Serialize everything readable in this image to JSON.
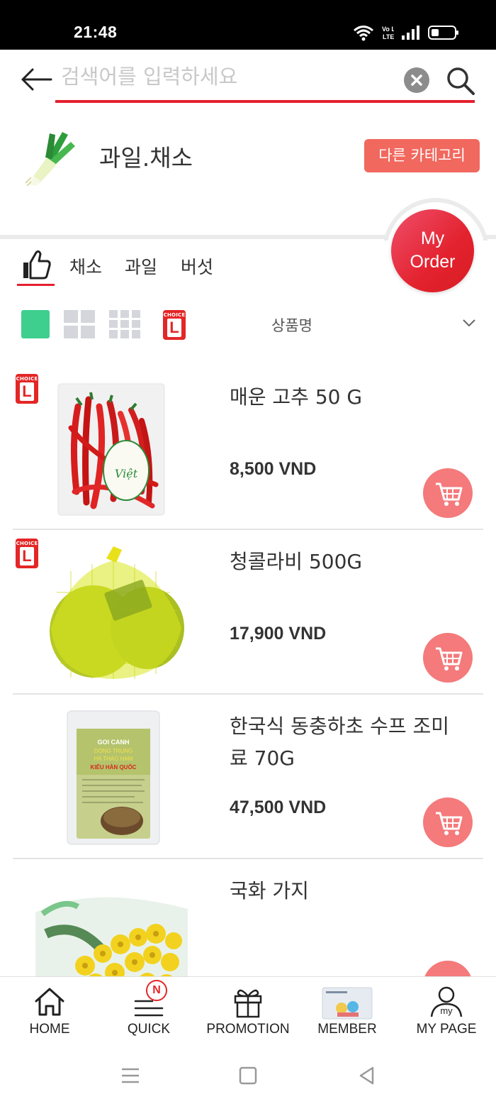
{
  "status_bar": {
    "time": "21:48",
    "network_label": "Vo LTE"
  },
  "search": {
    "placeholder": "검색어를 입력하세요",
    "value": ""
  },
  "category": {
    "title": "과일.채소",
    "other_button": "다른 카테고리"
  },
  "my_order": {
    "line1": "My",
    "line2": "Order"
  },
  "tabs": [
    {
      "label": "채소"
    },
    {
      "label": "과일"
    },
    {
      "label": "버섯"
    }
  ],
  "choice_badge": {
    "top": "CHOICE",
    "letter": "L"
  },
  "sort": {
    "label": "상품명"
  },
  "products": [
    {
      "name": "매운 고추 50 G",
      "price": "8,500 VND",
      "choice": true
    },
    {
      "name": "청콜라비 500G",
      "price": "17,900 VND",
      "choice": true
    },
    {
      "name": "한국식 동충하초 수프 조미료 70G",
      "price": "47,500 VND",
      "choice": false,
      "package_text": {
        "line1": "GOI CANH",
        "line2": "DONG TRUNG",
        "line3": "HA THAO HAM",
        "line4": "KIỂU HÀN QUỐC"
      }
    },
    {
      "name": "국화 가지",
      "price": "",
      "choice": false
    }
  ],
  "product_image_text": {
    "pepper_label": "Việt"
  },
  "bottom_nav": [
    {
      "label": "HOME",
      "icon": "home-icon"
    },
    {
      "label": "QUICK",
      "icon": "menu-icon",
      "badge": "N"
    },
    {
      "label": "PROMOTION",
      "icon": "gift-icon"
    },
    {
      "label": "MEMBER",
      "icon": "membership-card-icon"
    },
    {
      "label": "MY PAGE",
      "icon": "user-icon",
      "icon_text": "my"
    }
  ],
  "colors": {
    "accent_red": "#e5202e",
    "category_button": "#f1685e",
    "cart_button": "#f47a7b",
    "grid_view_active": "#3ecf8e",
    "grid_view_inactive": "#d4d6dc"
  }
}
